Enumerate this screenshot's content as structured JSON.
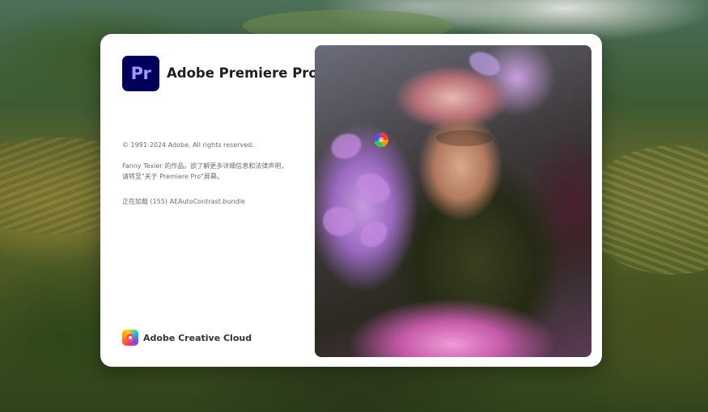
{
  "splash": {
    "app_icon_text": "Pr",
    "app_title": "Adobe Premiere Pro",
    "copyright": "© 1991-2024 Adobe. All rights reserved.",
    "credit": "Fanny Texier 的作品。欲了解更多详细信息和法律声明，请转至\"关于 Premiere Pro\"屏幕。",
    "loading_status": "正在加载 (155) AEAutoContrast.bundle",
    "footer_brand": "Adobe Creative Cloud"
  },
  "colors": {
    "premiere_icon_bg": "#00005b",
    "premiere_icon_text": "#9999ff",
    "panel_bg": "#ffffff"
  },
  "icons": {
    "app_icon": "premiere-pro-logo",
    "footer_icon": "creative-cloud-logo",
    "loader": "loading-spinner"
  }
}
